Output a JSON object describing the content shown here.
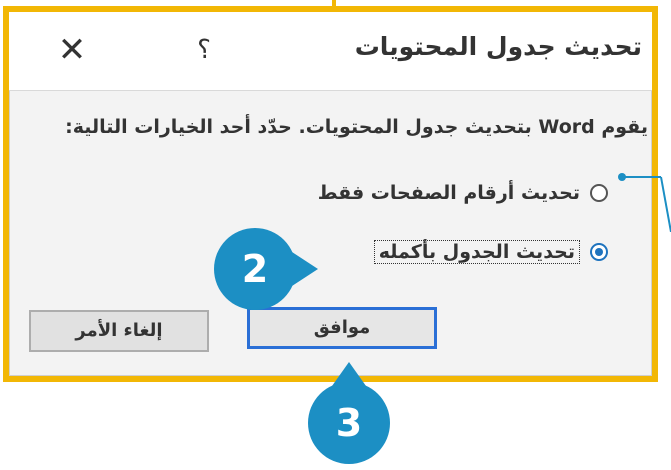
{
  "dialog": {
    "title": "تحديث جدول المحتويات",
    "help_label": "؟",
    "close_label": "✕",
    "message": "يقوم Word بتحديث جدول المحتويات. حدّد أحد الخيارات التالية:",
    "options": [
      {
        "label": "تحديث أرقام الصفحات فقط",
        "selected": false
      },
      {
        "label": "تحديث الجدول بأكمله",
        "selected": true
      }
    ],
    "ok_label": "موافق",
    "cancel_label": "إلغاء الأمر"
  },
  "callouts": {
    "step2": "2",
    "step3": "3"
  },
  "colors": {
    "frame": "#f2b705",
    "callout": "#1c8fc4",
    "radio_selected": "#1e73be",
    "primary_button_border": "#2a6fd6"
  }
}
